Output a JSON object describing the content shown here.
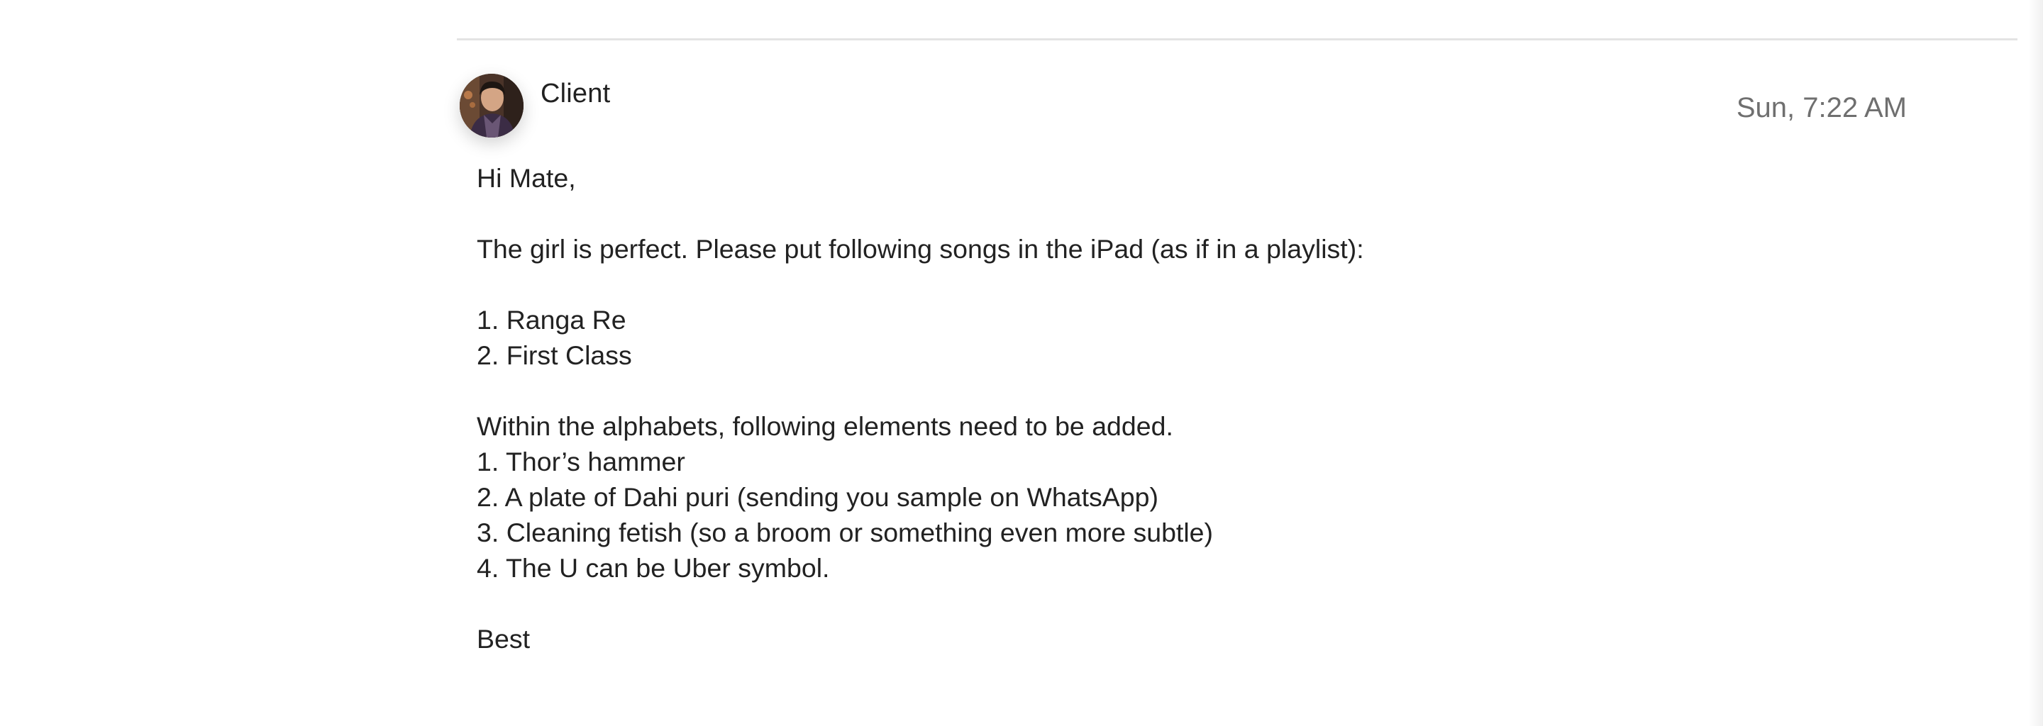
{
  "email": {
    "sender": {
      "name": "Client",
      "avatar": "client-avatar"
    },
    "timestamp": "Sun, 7:22 AM",
    "body": {
      "greeting": "Hi Mate,",
      "intro": "The girl is perfect. Please put following songs in the iPad (as if in a playlist):",
      "songs": [
        "1. Ranga Re",
        "2. First Class"
      ],
      "elements_intro": "Within the alphabets, following elements need to be added.",
      "elements": [
        "1. Thor’s hammer",
        "2. A plate of Dahi puri (sending you sample on WhatsApp)",
        "3. Cleaning fetish (so a broom or something even more subtle)",
        "4. The U can be Uber symbol."
      ],
      "signoff": "Best"
    }
  },
  "colors": {
    "text": "#222222",
    "timestamp": "#6f6f6f",
    "divider": "#e3e3e3"
  }
}
